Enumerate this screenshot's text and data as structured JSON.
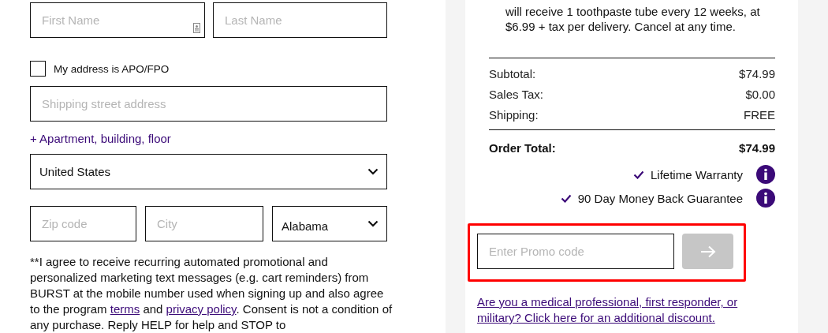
{
  "shipping_form": {
    "first_name": {
      "placeholder": "First Name"
    },
    "last_name": {
      "placeholder": "Last Name"
    },
    "apo_fpo": {
      "label": "My address is APO/FPO",
      "checked": false
    },
    "street": {
      "placeholder": "Shipping street address"
    },
    "apartment_link": "+ Apartment, building, floor",
    "country": {
      "value": "United States"
    },
    "zip": {
      "placeholder": "Zip code"
    },
    "city": {
      "placeholder": "City"
    },
    "state": {
      "value": "Alabama"
    },
    "consent": {
      "before": "**I agree to receive recurring automated promotional and personalized marketing text messages (e.g. cart reminders) from BURST at the mobile number used when signing up and also agree to the program",
      "terms_link": "terms",
      "middle": "and",
      "privacy_link": "privacy policy",
      "after": ". Consent is not a condition of any purchase. Reply HELP for help and STOP to"
    }
  },
  "order_summary": {
    "subscription_note": "will receive 1 toothpaste tube every 12 weeks, at $6.99 + tax per delivery. Cancel at any time.",
    "rows": [
      {
        "label": "Subtotal:",
        "value": "$74.99",
        "kind": "line"
      },
      {
        "label": "Sales Tax:",
        "value": "$0.00",
        "kind": "line"
      },
      {
        "label": "Shipping:",
        "value": "FREE",
        "kind": "line"
      },
      {
        "label": "Order Total:",
        "value": "$74.99",
        "kind": "total"
      }
    ],
    "guarantees": [
      "Lifetime Warranty",
      "90 Day Money Back Guarantee"
    ],
    "promo": {
      "placeholder": "Enter Promo code",
      "highlighted": true
    },
    "discount_link": "Are you a medical professional, first responder, or military? Click here for an additional discount."
  }
}
